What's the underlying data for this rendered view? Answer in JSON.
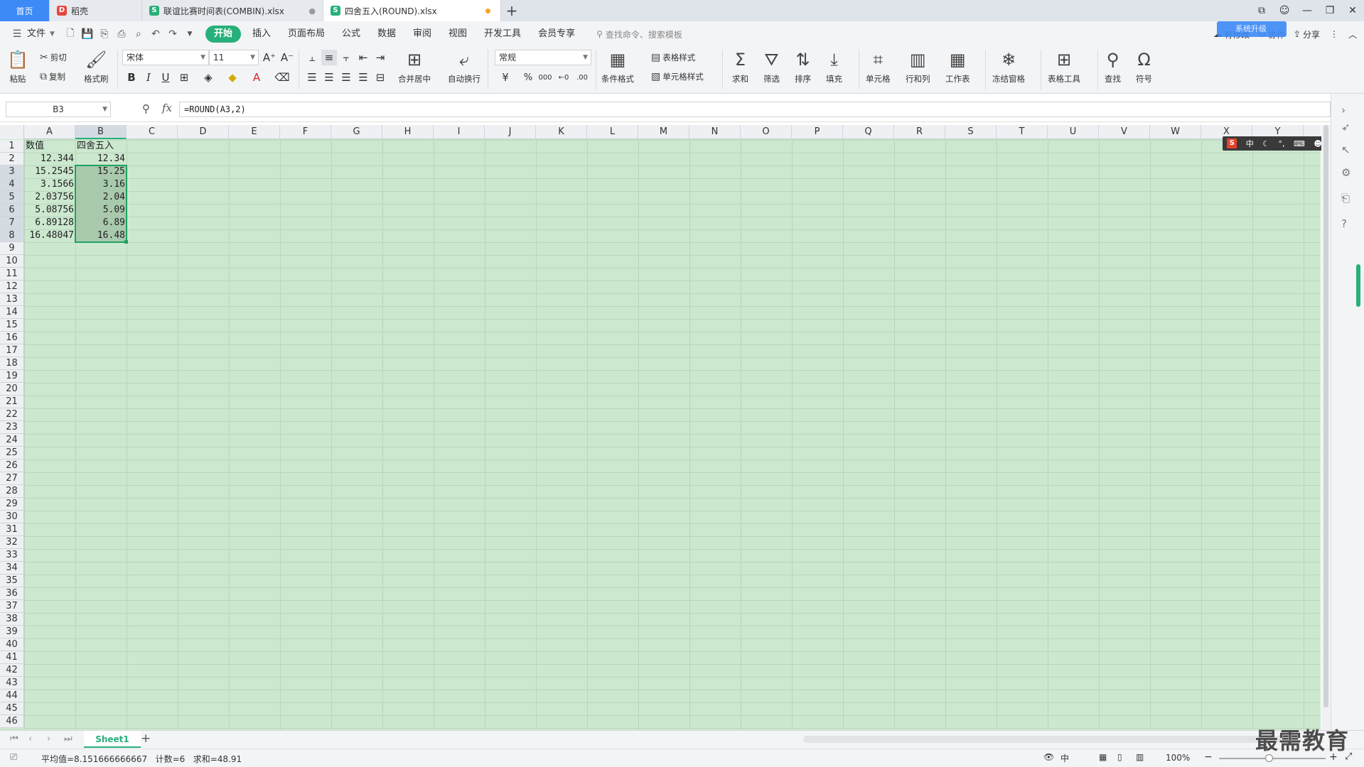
{
  "tabs": [
    {
      "label": "首页",
      "kind": "home"
    },
    {
      "label": "稻壳",
      "kind": "docer"
    },
    {
      "label": "联谊比赛时间表(COMBIN).xlsx",
      "kind": "sheet"
    },
    {
      "label": "四舍五入(ROUND).xlsx",
      "kind": "sheet",
      "active": true
    }
  ],
  "tab_add": "+",
  "menu": {
    "file": "文件",
    "items": [
      "开始",
      "插入",
      "页面布局",
      "公式",
      "数据",
      "审阅",
      "视图",
      "开发工具",
      "会员专享"
    ],
    "active": "开始",
    "search_placeholder": "查找命令、搜索模板",
    "right_sync": "有修改",
    "right_collab": "协作",
    "right_share": "分享",
    "cloud_label": "系统升级"
  },
  "ribbon": {
    "paste": "粘贴",
    "cut": "剪切",
    "copy": "复制",
    "format_painter": "格式刷",
    "font_name": "宋体",
    "font_size": "11",
    "merge_center": "合并居中",
    "wrap_text": "自动换行",
    "number_format": "常规",
    "table_style": "表格样式",
    "cell_style": "单元格样式",
    "cond_format": "条件格式",
    "sum": "求和",
    "filter": "筛选",
    "sort": "排序",
    "fill": "填充",
    "cell": "单元格",
    "row_col": "行和列",
    "worksheet": "工作表",
    "freeze": "冻结窗格",
    "table_tools": "表格工具",
    "find": "查找",
    "symbol": "符号",
    "currency_symbol": "¥",
    "percent_symbol": "%",
    "thousands": "000"
  },
  "formula_bar": {
    "name_box": "B3",
    "fx": "fx",
    "formula": "=ROUND(A3,2)"
  },
  "columns": [
    "A",
    "B",
    "C",
    "D",
    "E",
    "F",
    "G",
    "H",
    "I",
    "J",
    "K",
    "L",
    "M",
    "N",
    "O",
    "P",
    "Q",
    "R",
    "S",
    "T",
    "U",
    "V",
    "W",
    "X",
    "Y"
  ],
  "selected_column": "B",
  "rows": [
    "1",
    "2",
    "3",
    "4",
    "5",
    "6",
    "7",
    "8",
    "9",
    "10",
    "11",
    "12",
    "13",
    "14",
    "15",
    "16",
    "17",
    "18",
    "19",
    "20",
    "21",
    "22",
    "23",
    "24",
    "25",
    "26",
    "27",
    "28",
    "29",
    "30",
    "31",
    "32",
    "33",
    "34",
    "35",
    "36",
    "37",
    "38",
    "39",
    "40",
    "41",
    "42",
    "43",
    "44",
    "45",
    "46"
  ],
  "table": {
    "header": [
      "数值",
      "四舍五入"
    ],
    "data": [
      [
        "12.344",
        "12.34"
      ],
      [
        "15.2545",
        "15.25"
      ],
      [
        "3.1566",
        "3.16"
      ],
      [
        "2.03756",
        "2.04"
      ],
      [
        "5.08756",
        "5.09"
      ],
      [
        "6.89128",
        "6.89"
      ],
      [
        "16.48047",
        "16.48"
      ]
    ]
  },
  "ime": {
    "logo": "S",
    "mode": "中"
  },
  "sheet": {
    "name": "Sheet1",
    "add": "+"
  },
  "status": {
    "avg": "平均值=8.151666666667",
    "count": "计数=6",
    "sum": "求和=48.91",
    "zoom": "100%"
  },
  "watermark": "最需教育",
  "colors": {
    "accent": "#27b07a",
    "sheet_bg": "#cce8cf",
    "home_tab": "#3d8af7"
  }
}
